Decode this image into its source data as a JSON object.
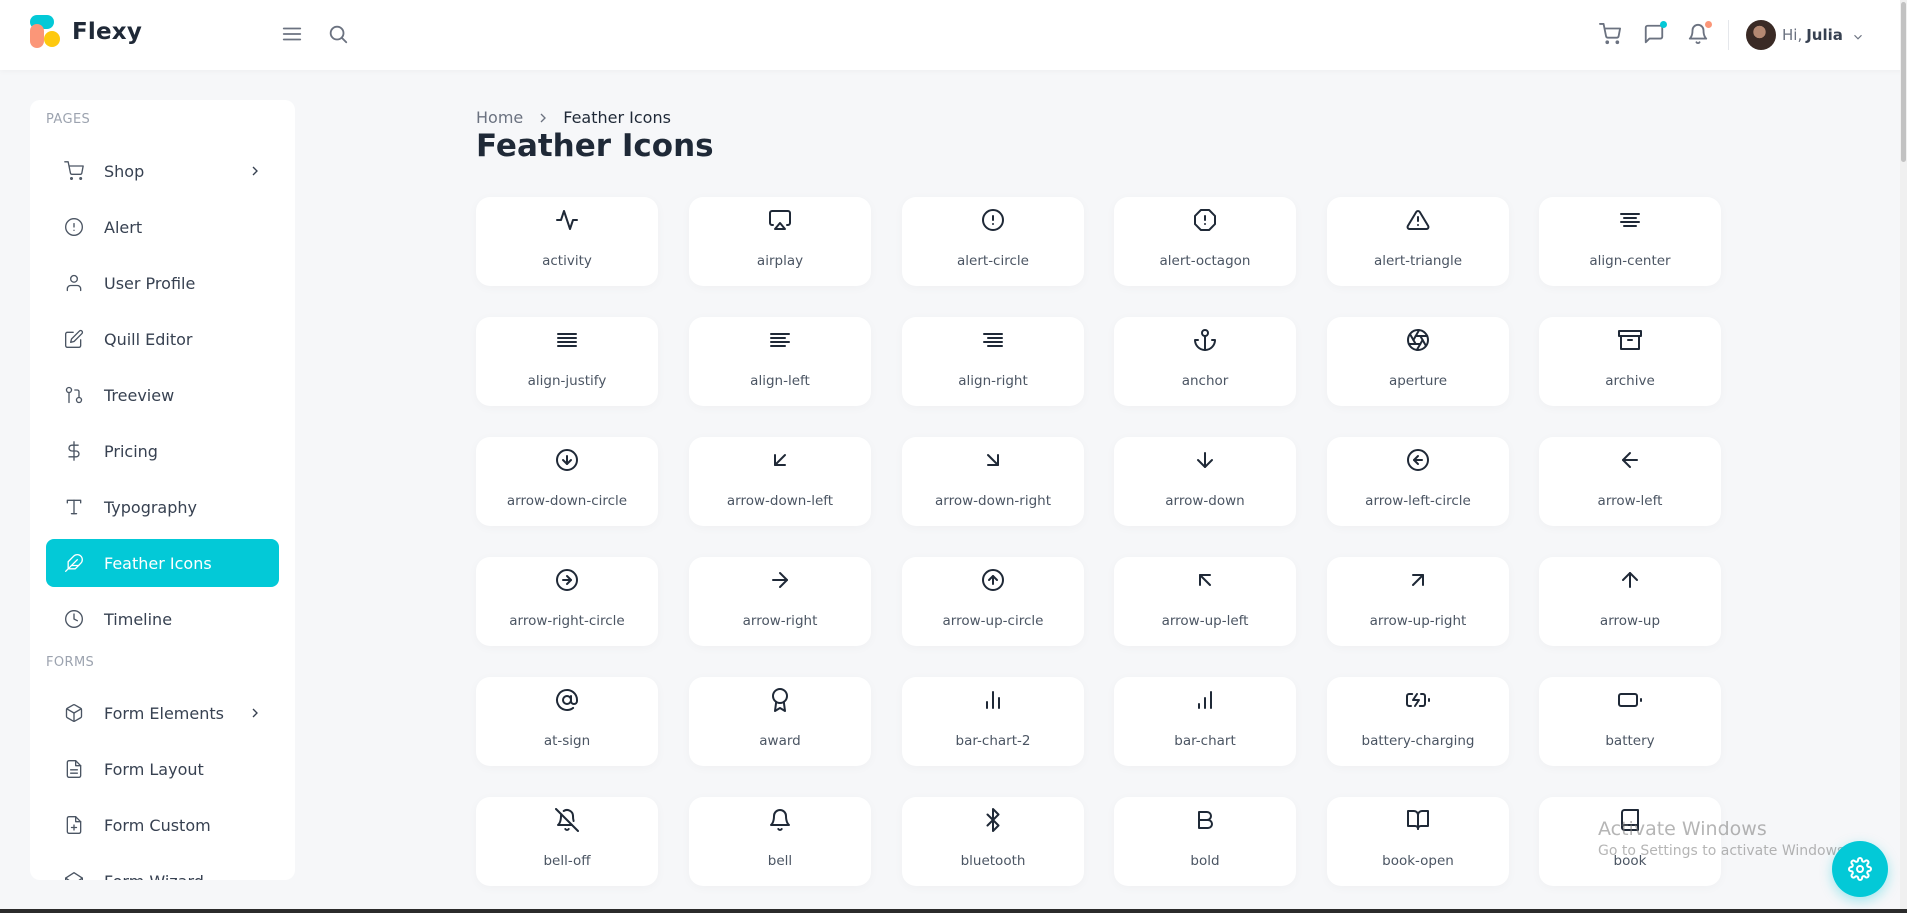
{
  "app": {
    "name": "Flexy",
    "colors": {
      "accent": "#03c9d7",
      "text": "#1f2937",
      "muted": "#6b7280",
      "background": "#f6f7f9"
    }
  },
  "header": {
    "menu_icon": "menu-icon",
    "search_icon": "search-icon",
    "cart_icon": "shopping-cart-icon",
    "messages_icon": "message-square-icon",
    "notifications_icon": "bell-icon",
    "greeting": "Hi,",
    "user_name": "Julia"
  },
  "sidebar": {
    "sections": [
      {
        "label": "PAGES"
      },
      {
        "label": "FORMS"
      }
    ],
    "items": [
      {
        "label": "Shop",
        "icon": "shopping-cart-icon",
        "has_children": true
      },
      {
        "label": "Alert",
        "icon": "alert-circle-icon"
      },
      {
        "label": "User Profile",
        "icon": "user-icon"
      },
      {
        "label": "Quill Editor",
        "icon": "edit-icon"
      },
      {
        "label": "Treeview",
        "icon": "git-pull-request-icon"
      },
      {
        "label": "Pricing",
        "icon": "dollar-sign-icon"
      },
      {
        "label": "Typography",
        "icon": "type-icon"
      },
      {
        "label": "Feather Icons",
        "icon": "feather-icon",
        "active": true
      },
      {
        "label": "Timeline",
        "icon": "clock-icon"
      },
      {
        "label": "Form Elements",
        "icon": "box-icon",
        "has_children": true
      },
      {
        "label": "Form Layout",
        "icon": "file-text-icon"
      },
      {
        "label": "Form Custom",
        "icon": "file-plus-icon"
      },
      {
        "label": "Form Wizard",
        "icon": "codepen-icon"
      }
    ]
  },
  "breadcrumb": {
    "home": "Home",
    "current": "Feather Icons"
  },
  "page": {
    "title": "Feather Icons"
  },
  "icons": [
    "activity",
    "airplay",
    "alert-circle",
    "alert-octagon",
    "alert-triangle",
    "align-center",
    "align-justify",
    "align-left",
    "align-right",
    "anchor",
    "aperture",
    "archive",
    "arrow-down-circle",
    "arrow-down-left",
    "arrow-down-right",
    "arrow-down",
    "arrow-left-circle",
    "arrow-left",
    "arrow-right-circle",
    "arrow-right",
    "arrow-up-circle",
    "arrow-up-left",
    "arrow-up-right",
    "arrow-up",
    "at-sign",
    "award",
    "bar-chart-2",
    "bar-chart",
    "battery-charging",
    "battery",
    "bell-off",
    "bell",
    "bluetooth",
    "bold",
    "book-open",
    "book"
  ],
  "watermark": {
    "line1": "Activate Windows",
    "line2": "Go to Settings to activate Windows."
  },
  "settings_fab": {
    "icon": "settings-icon"
  }
}
